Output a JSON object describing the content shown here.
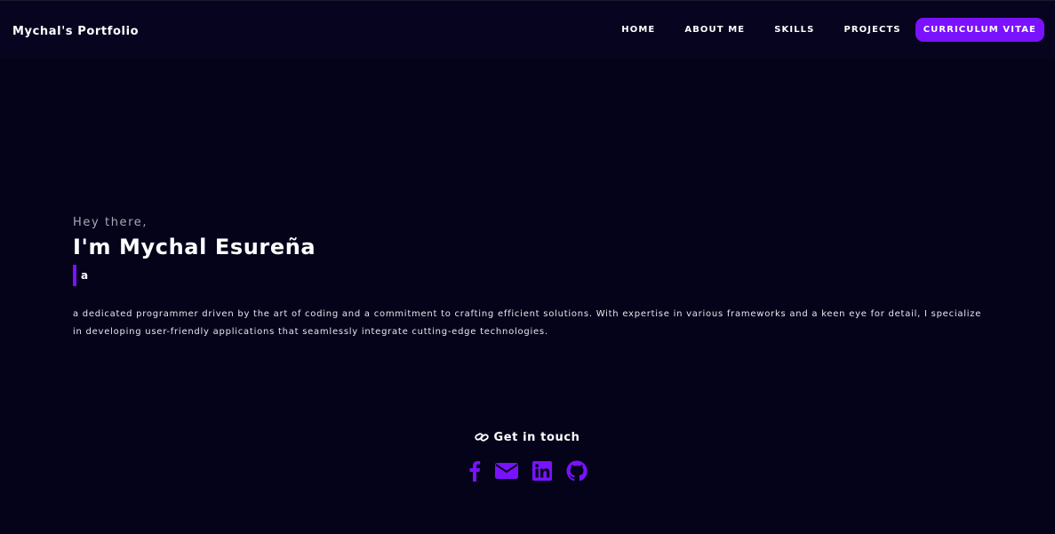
{
  "navbar": {
    "brand": "Mychal's Portfolio",
    "links": [
      "HOME",
      "ABOUT ME",
      "SKILLS",
      "PROJECTS"
    ],
    "cv_button": "CURRICULUM VITAE"
  },
  "hero": {
    "greeting": "Hey there,",
    "name": "I'm Mychal Esureña",
    "typed_text": "a",
    "bio": "a dedicated programmer driven by the art of coding and a commitment to crafting efficient solutions. With expertise in various frameworks and a keen eye for detail, I specialize in developing user-friendly applications that seamlessly integrate cutting-edge technologies."
  },
  "contact": {
    "heading": "Get in touch",
    "heading_icon": "link-icon",
    "socials": [
      "facebook-icon",
      "email-icon",
      "linkedin-icon",
      "github-icon"
    ]
  },
  "colors": {
    "background": "#05031a",
    "navbar": "#07041f",
    "accent": "#7a12ff",
    "text": "#ffffff",
    "muted": "#a8a8b4"
  }
}
